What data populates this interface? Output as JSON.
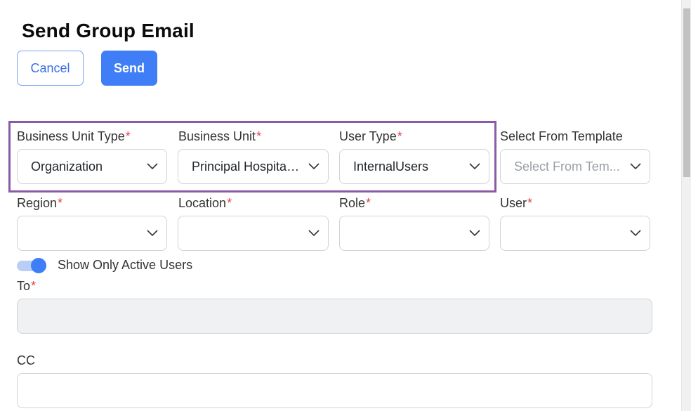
{
  "header": {
    "title": "Send Group Email",
    "cancel_label": "Cancel",
    "send_label": "Send"
  },
  "filters": {
    "business_unit_type": {
      "label": "Business Unit Type",
      "required": "*",
      "value": "Organization"
    },
    "business_unit": {
      "label": "Business Unit",
      "required": "*",
      "value": "Principal Hospital..."
    },
    "user_type": {
      "label": "User Type",
      "required": "*",
      "value": "InternalUsers"
    },
    "template": {
      "label": "Select From Template",
      "placeholder": "Select From Tem..."
    },
    "region": {
      "label": "Region",
      "required": "*",
      "value": ""
    },
    "location": {
      "label": "Location",
      "required": "*",
      "value": ""
    },
    "role": {
      "label": "Role",
      "required": "*",
      "value": ""
    },
    "user": {
      "label": "User",
      "required": "*",
      "value": ""
    }
  },
  "toggle": {
    "label": "Show Only Active Users",
    "state": "on"
  },
  "to": {
    "label": "To",
    "required": "*",
    "value": ""
  },
  "cc": {
    "label": "CC",
    "value": ""
  },
  "colors": {
    "accent": "#3f7ef6",
    "highlight": "#8a5aa6",
    "required": "#e0454b"
  },
  "icons": {
    "dropdown": "chevron-down-icon"
  }
}
